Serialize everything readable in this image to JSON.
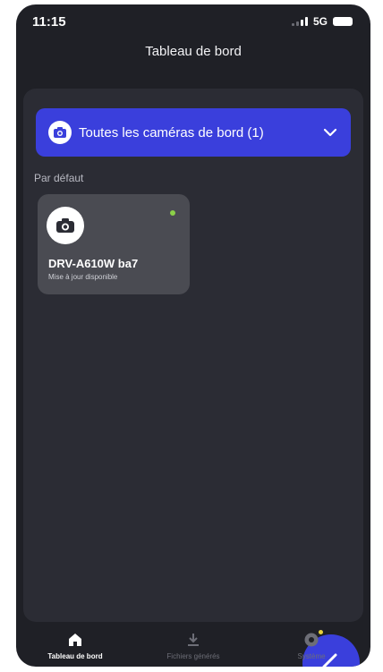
{
  "status_bar": {
    "time": "11:15",
    "network": "5G"
  },
  "header": {
    "title": "Tableau de bord"
  },
  "camera_selector": {
    "label": "Toutes les caméras de bord (1)",
    "icon": "camera-icon",
    "chevron_icon": "chevron-down-icon"
  },
  "section": {
    "label": "Par défaut"
  },
  "device_card": {
    "name": "DRV-A610W ba7",
    "status": "Mise à jour disponible",
    "icon": "camera-icon",
    "status_dot_color": "#8bd048"
  },
  "fab": {
    "icon": "edit-pen-icon"
  },
  "bottom_nav": {
    "items": [
      {
        "label": "Tableau de bord",
        "icon": "home-icon",
        "active": true
      },
      {
        "label": "Fichiers générés",
        "icon": "download-icon",
        "active": false
      },
      {
        "label": "Système",
        "icon": "settings-icon",
        "active": false
      }
    ]
  },
  "colors": {
    "accent": "#3a3fdc",
    "background": "#1f2026",
    "panel": "#2b2c34",
    "card": "#4a4b52",
    "badge": "#e8d13a"
  }
}
